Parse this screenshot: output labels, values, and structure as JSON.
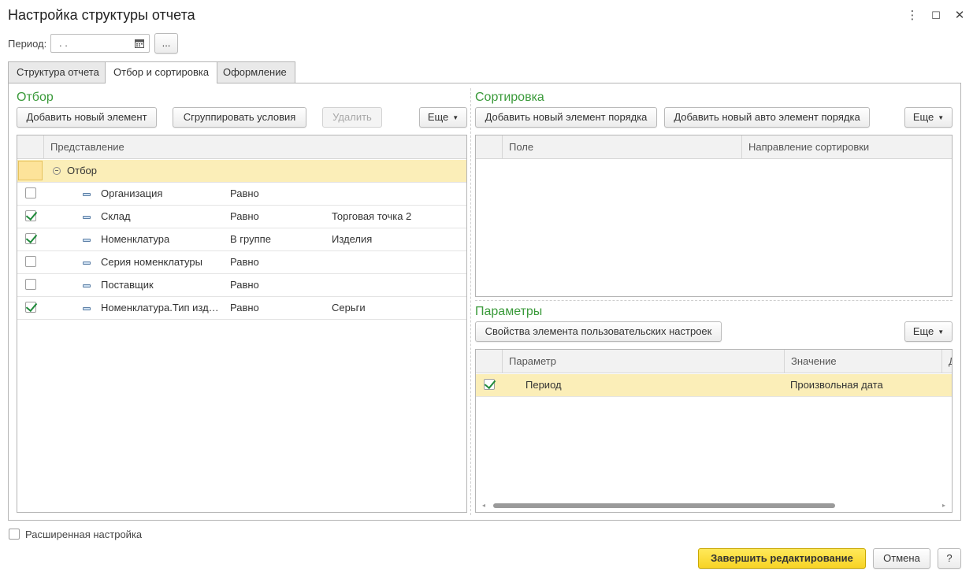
{
  "window": {
    "title": "Настройка структуры отчета",
    "menu_icon": "⋮",
    "maximize_icon": "☐",
    "close_icon": "✕"
  },
  "period": {
    "label": "Период:",
    "value": " .  .",
    "more_label": "..."
  },
  "tabs": [
    {
      "label": "Структура отчета"
    },
    {
      "label": "Отбор и сортировка"
    },
    {
      "label": "Оформление"
    }
  ],
  "filter": {
    "title": "Отбор",
    "add_label": "Добавить новый элемент",
    "group_label": "Сгруппировать условия",
    "delete_label": "Удалить",
    "more_label": "Еще",
    "header": "Представление",
    "root_label": "Отбор",
    "rows": [
      {
        "field": "Организация",
        "condition": "Равно",
        "value": "",
        "checked": false
      },
      {
        "field": "Склад",
        "condition": "Равно",
        "value": "Торговая точка 2",
        "checked": true
      },
      {
        "field": "Номенклатура",
        "condition": "В группе",
        "value": "Изделия",
        "checked": true
      },
      {
        "field": "Серия номенклатуры",
        "condition": "Равно",
        "value": "",
        "checked": false
      },
      {
        "field": "Поставщик",
        "condition": "Равно",
        "value": "",
        "checked": false
      },
      {
        "field": "Номенклатура.Тип изд…",
        "condition": "Равно",
        "value": "Серьги",
        "checked": true
      }
    ]
  },
  "sorting": {
    "title": "Сортировка",
    "add_label": "Добавить новый элемент порядка",
    "add_auto_label": "Добавить новый авто элемент порядка",
    "more_label": "Еще",
    "col_field": "Поле",
    "col_direction": "Направление сортировки"
  },
  "params": {
    "title": "Параметры",
    "props_label": "Свойства элемента пользовательских настроек",
    "more_label": "Еще",
    "col_param": "Параметр",
    "col_value": "Значение",
    "col_extra": "Д",
    "rows": [
      {
        "param": "Период",
        "value": "Произвольная дата",
        "checked": true
      }
    ]
  },
  "footer": {
    "advanced_label": "Расширенная настройка",
    "finish_label": "Завершить редактирование",
    "cancel_label": "Отмена",
    "help_label": "?"
  },
  "colors": {
    "accent_green": "#3a9a3a",
    "selection": "#fbeeb8",
    "primary_button": "#f7d325"
  }
}
